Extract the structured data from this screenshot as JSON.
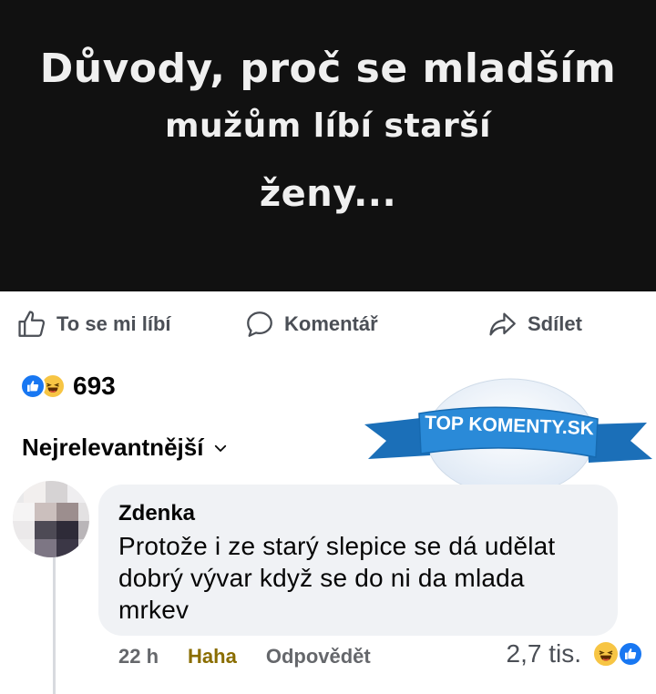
{
  "post": {
    "lines": [
      "Důvody, proč se mladším",
      "mužům líbí starší",
      "ženy..."
    ]
  },
  "actions": {
    "like_label": "To se mi líbí",
    "comment_label": "Komentář",
    "share_label": "Sdílet"
  },
  "reactions": {
    "count": "693",
    "icons": [
      "like-icon",
      "haha-icon"
    ]
  },
  "sort": {
    "label": "Nejrelevantnější"
  },
  "comment": {
    "author": "Zdenka",
    "text": "Protože i ze starý slepice se dá udělat dobrý vývar když se do ni da mlada mrkev",
    "time": "22 h",
    "reaction_label": "Haha",
    "reply_label": "Odpovědět",
    "reaction_count": "2,7 tis."
  },
  "watermark": {
    "text": "TOP KOMENTY.SK"
  },
  "colors": {
    "facebook_blue": "#1877f2",
    "haha_yellow": "#f7c544",
    "post_bg": "#111111",
    "bubble_bg": "#f0f2f5"
  }
}
